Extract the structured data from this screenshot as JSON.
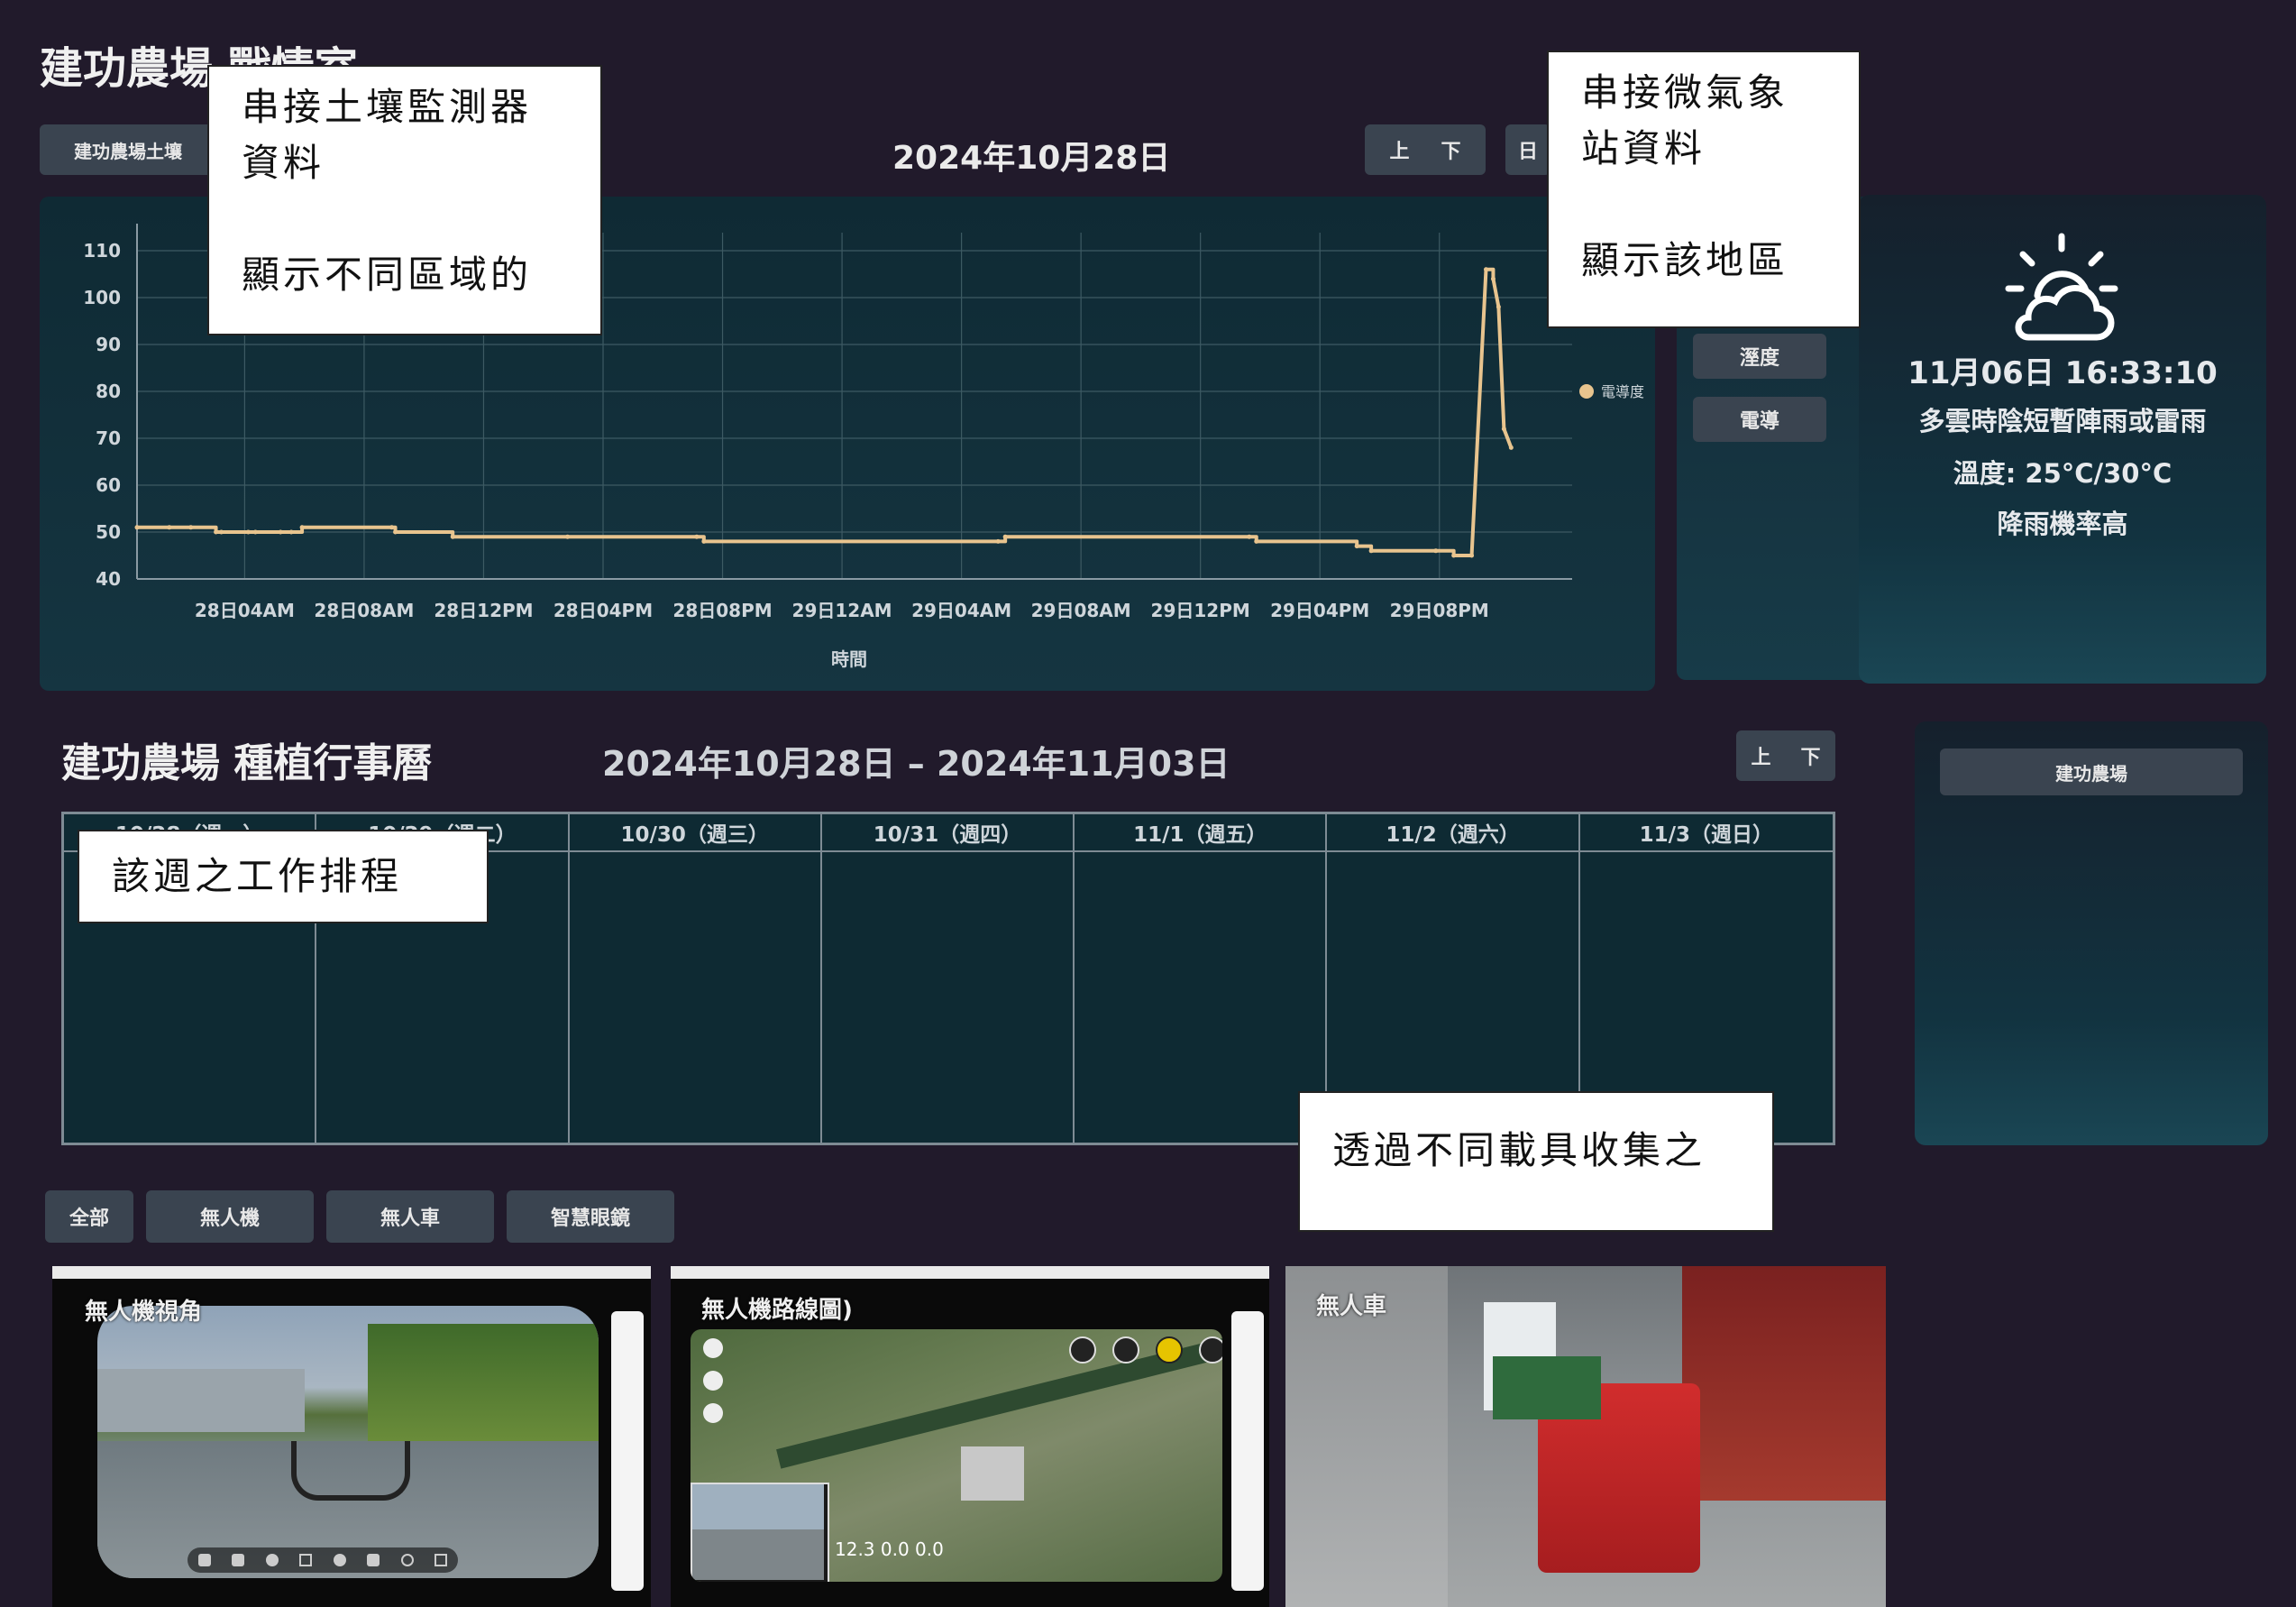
{
  "header": {
    "title": "建功農場 戰情室",
    "source_button": "建功農場土壤",
    "date": "2024年10月28日",
    "nav_up": "上",
    "nav_down": "下",
    "nav_day": "日"
  },
  "sensor_buttons": {
    "humidity": "溼度",
    "ec": "電導"
  },
  "weather": {
    "icon": "partly-cloudy-sun-icon",
    "datetime": "11月06日 16:33:10",
    "forecast": "多雲時陰短暫陣雨或雷雨",
    "temperature": "溫度: 25°C/30°C",
    "rain": "降雨機率高"
  },
  "chart_data": {
    "type": "line",
    "title": "",
    "xlabel": "時間",
    "ylabel": "",
    "ylim": [
      40,
      110
    ],
    "yticks": [
      40,
      50,
      60,
      70,
      80,
      90,
      100,
      110
    ],
    "xticks": [
      "28日04AM",
      "28日08AM",
      "28日12PM",
      "28日04PM",
      "28日08PM",
      "29日12AM",
      "29日04AM",
      "29日08AM",
      "29日12PM",
      "29日04PM",
      "29日08PM"
    ],
    "grid": true,
    "legend_position": "right",
    "series": [
      {
        "name": "電導度",
        "color": "#e8c48e",
        "x": [
          0,
          0.9,
          1.5,
          2.2,
          2.35,
          3.1,
          3.3,
          4.0,
          4.3,
          4.6,
          7.1,
          7.2,
          8.8,
          12.0,
          15.6,
          15.8,
          24.0,
          24.2,
          31.0,
          31.2,
          34.0,
          34.4,
          36.2,
          36.7,
          37.2,
          37.6,
          37.8,
          37.95,
          38.1,
          38.3
        ],
        "y": [
          51,
          51,
          51,
          50,
          50,
          50,
          50,
          50,
          50,
          51,
          51,
          50,
          49,
          49,
          49,
          48,
          48,
          49,
          49,
          48,
          47,
          46,
          46,
          45,
          45,
          106,
          104,
          98,
          72,
          68
        ]
      }
    ]
  },
  "calendar": {
    "title": "建功農場 種植行事曆",
    "range": "2024年10月28日 – 2024年11月03日",
    "nav_up": "上",
    "nav_down": "下",
    "days": [
      "10/28（週一）",
      "10/29（週二）",
      "10/30（週三）",
      "10/31（週四）",
      "11/1（週五）",
      "11/2（週六）",
      "11/3（週日）"
    ]
  },
  "farm_panel": {
    "farm_button": "建功農場"
  },
  "filters": [
    "全部",
    "無人機",
    "無人車",
    "智慧眼鏡"
  ],
  "videos": {
    "drone_view": "無人機視角",
    "drone_map": "無人機路線圖)",
    "vehicle": "無人車",
    "map_readout": "12.3  0.0  0.0"
  },
  "notes": {
    "soil": "串接土壤監測器\n資料\n\n顯示不同區域的",
    "weather": "串接微氣象\n站資料\n\n顯示該地區",
    "schedule": "該週之工作排程",
    "vehicles": "透過不同載具收集之"
  },
  "colors": {
    "background": "#211a2b",
    "panel": "#0f2a34",
    "line": "#e8c48e"
  }
}
